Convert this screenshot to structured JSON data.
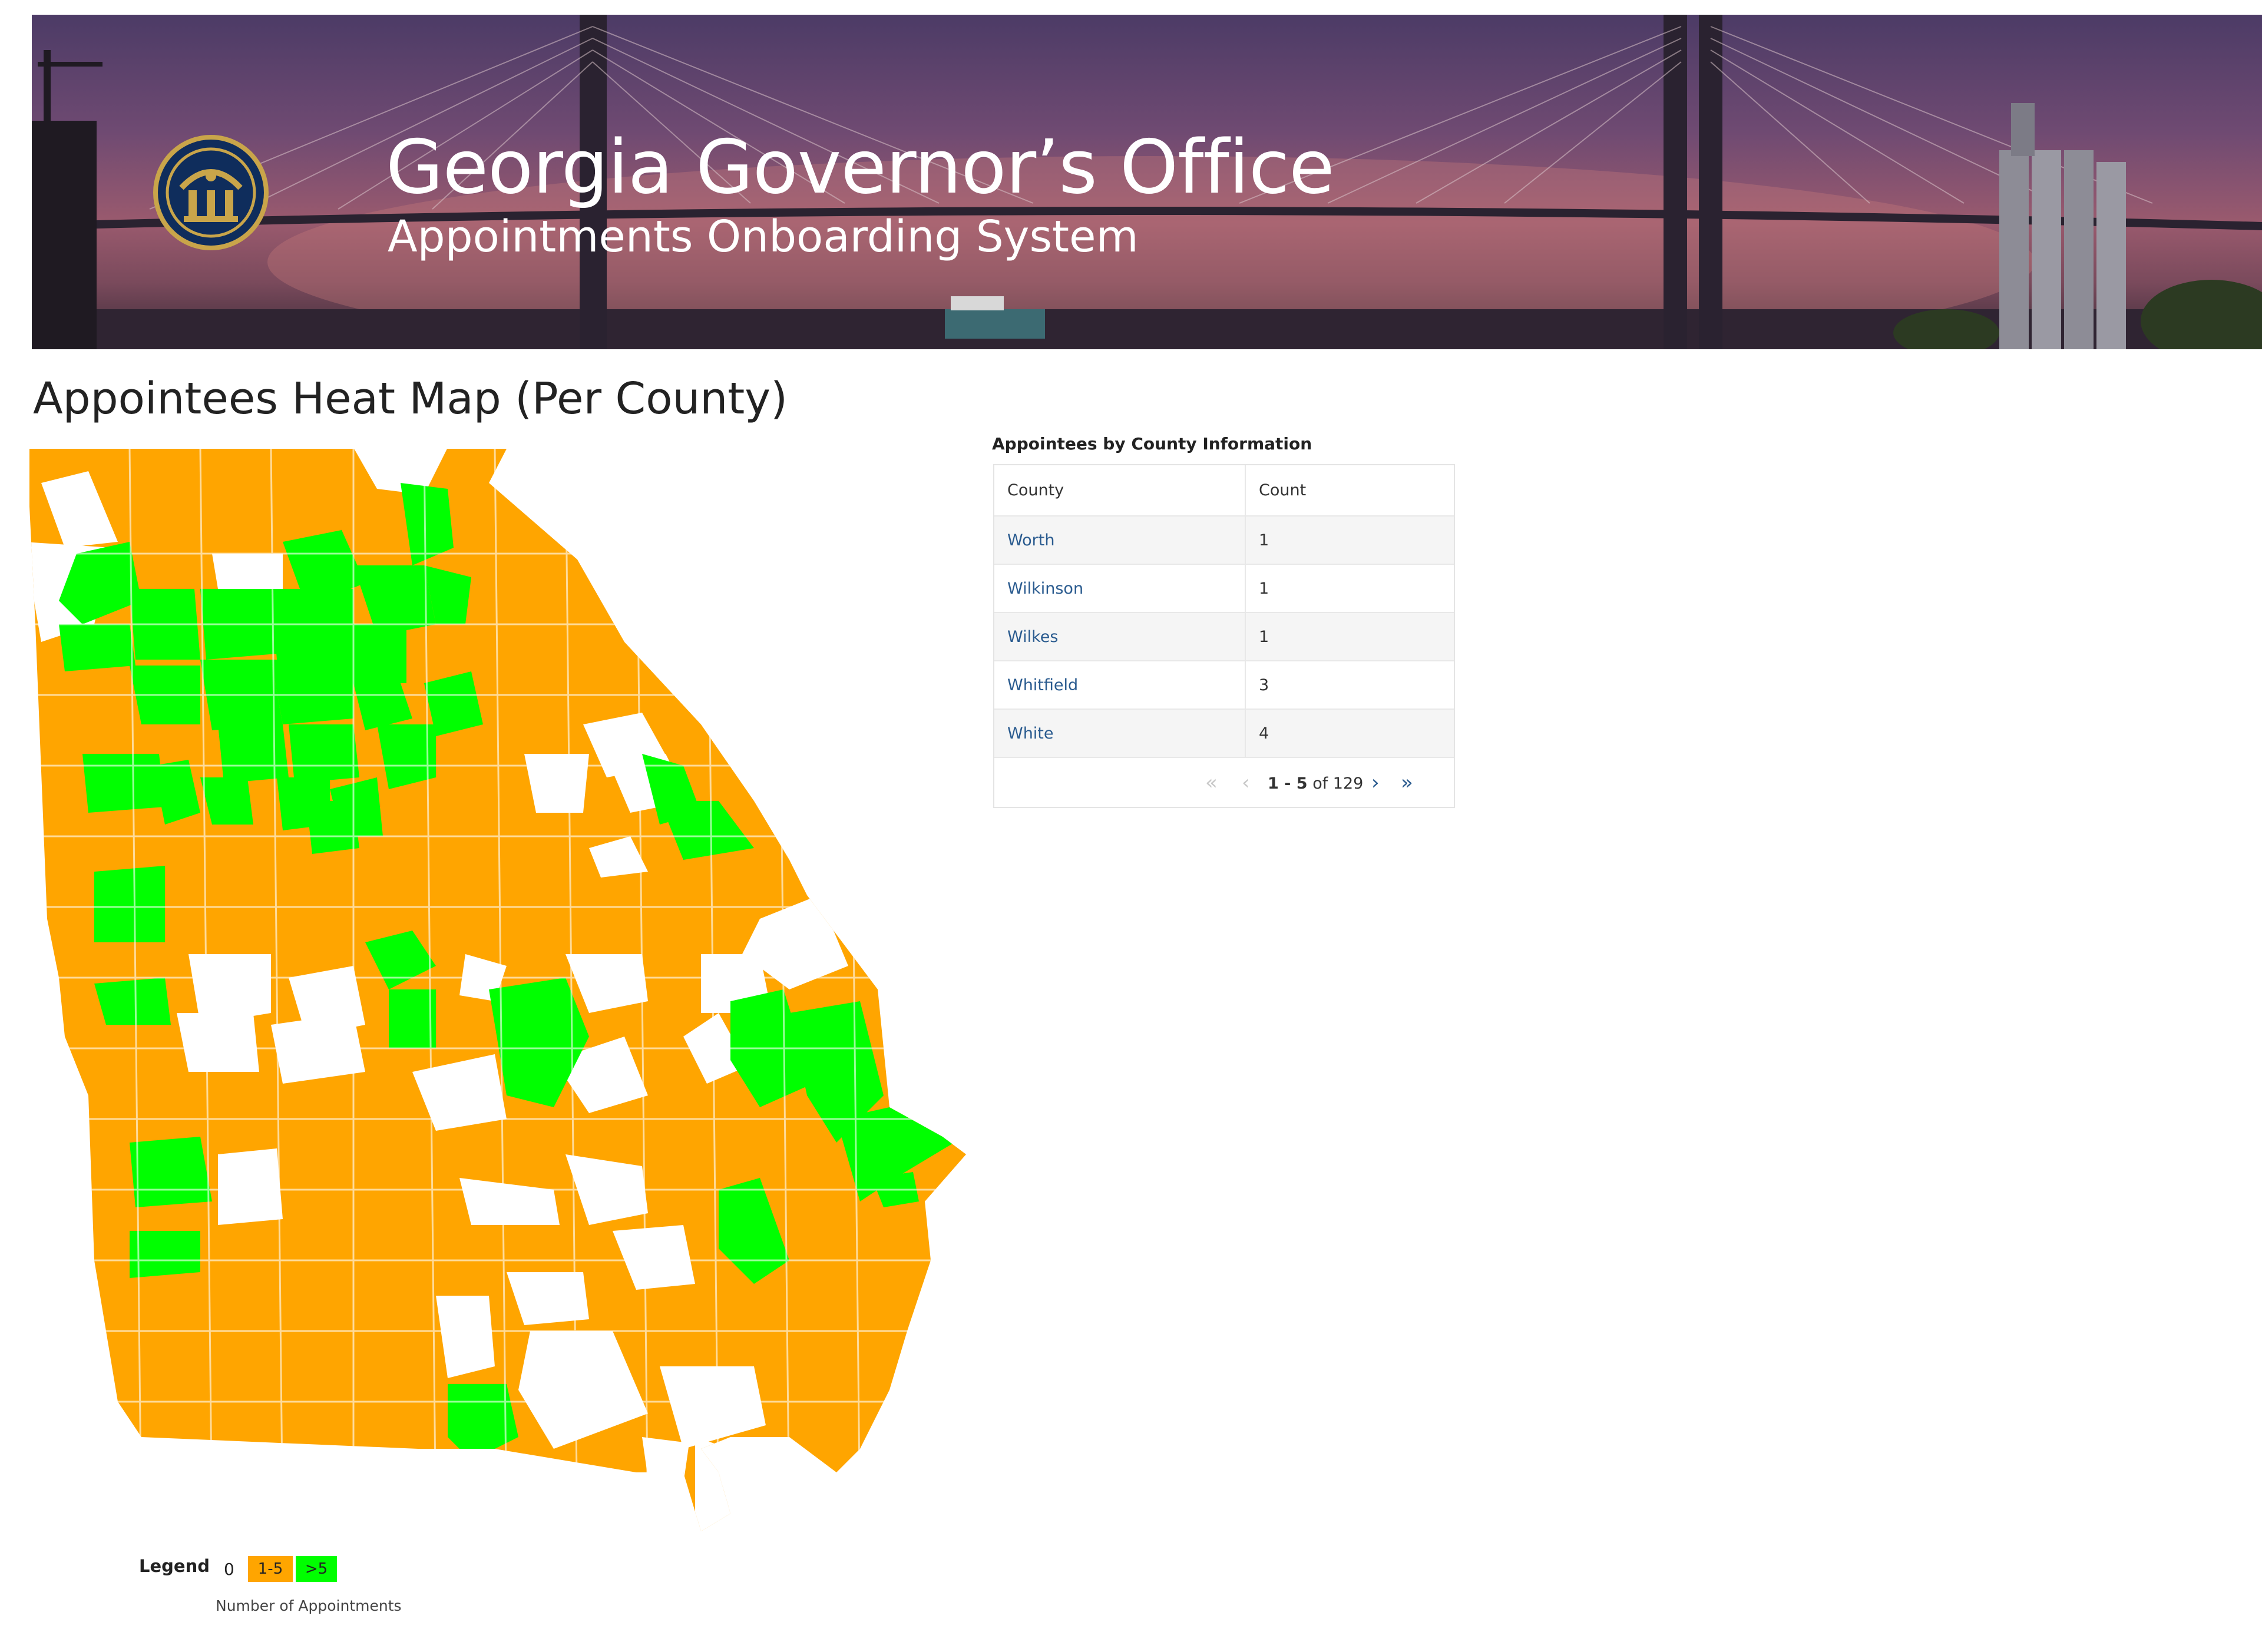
{
  "header": {
    "title": "Georgia Governor’s Office",
    "subtitle": "Appointments Onboarding System"
  },
  "page": {
    "heading": "Appointees Heat Map (Per County)"
  },
  "colors": {
    "zero": "#ffffff",
    "low": "#ffa500",
    "high": "#00ff00",
    "link": "#2a5b8f"
  },
  "legend": {
    "label": "Legend",
    "items": [
      {
        "label": "0",
        "color": "#ffffff"
      },
      {
        "label": "1-5",
        "color": "#ffa500"
      },
      {
        "label": ">5",
        "color": "#00ff00"
      }
    ],
    "caption": "Number of Appointments"
  },
  "table": {
    "caption": "Appointees by County Information",
    "columns": [
      "County",
      "Count"
    ],
    "rows": [
      {
        "county": "Worth",
        "count": "1"
      },
      {
        "county": "Wilkinson",
        "count": "1"
      },
      {
        "county": "Wilkes",
        "count": "1"
      },
      {
        "county": "Whitfield",
        "count": "3"
      },
      {
        "county": "White",
        "count": "4"
      }
    ],
    "pagination": {
      "range": "1 - 5",
      "of_label": "of 129",
      "first_icon": "double-chevron-left-icon",
      "prev_icon": "chevron-left-icon",
      "next_icon": "chevron-right-icon",
      "last_icon": "double-chevron-right-icon"
    }
  }
}
